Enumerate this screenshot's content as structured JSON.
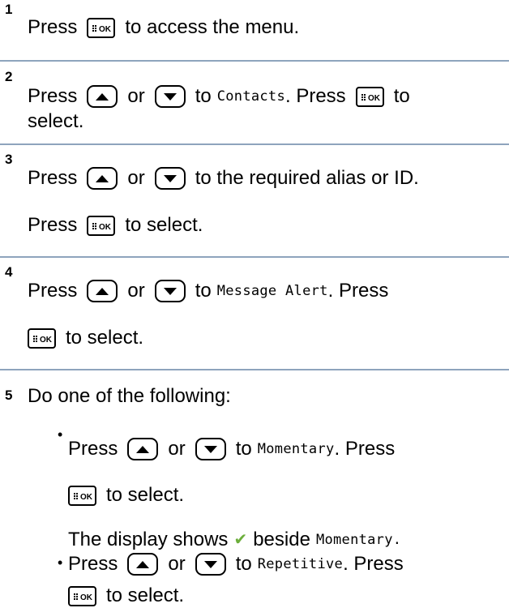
{
  "steps": [
    {
      "number": "1",
      "lines": [
        {
          "pre": "Press",
          "post": "to access the menu."
        }
      ]
    },
    {
      "number": "2",
      "lines": [
        {
          "pre": "Press",
          "or": "or",
          "to": "to",
          "target": "Contacts",
          "press": ". Press",
          "post": "to"
        },
        {
          "text": "select."
        }
      ]
    },
    {
      "number": "3",
      "lines": [
        {
          "pre": "Press",
          "or": "or",
          "post": "to the required alias or ID."
        },
        {
          "pre": "Press",
          "post": "to select."
        }
      ]
    },
    {
      "number": "4",
      "lines": [
        {
          "pre": "Press",
          "or": "or",
          "to": "to",
          "target": "Message Alert",
          "post": ". Press"
        },
        {
          "post": "to select."
        }
      ]
    },
    {
      "number": "5",
      "intro": "Do one of the following:",
      "options": [
        {
          "pre": "Press",
          "or": "or",
          "to": "to",
          "target": "Momentary",
          "post": ". Press",
          "select": "to select.",
          "display_pre": "The display shows",
          "display_mid": "beside",
          "display_target": "Momentary."
        },
        {
          "pre": "Press",
          "or": "or",
          "to": "to",
          "target": "Repetitive",
          "post": ". Press",
          "select": "to select."
        }
      ]
    }
  ],
  "keys": {
    "ok_icon": "menu-ok-key-icon",
    "up_icon": "up-arrow-key-icon",
    "down_icon": "down-arrow-key-icon",
    "ok_text": "OK"
  },
  "colors": {
    "rule": "#8ea4bd",
    "check": "#6cae3c"
  }
}
